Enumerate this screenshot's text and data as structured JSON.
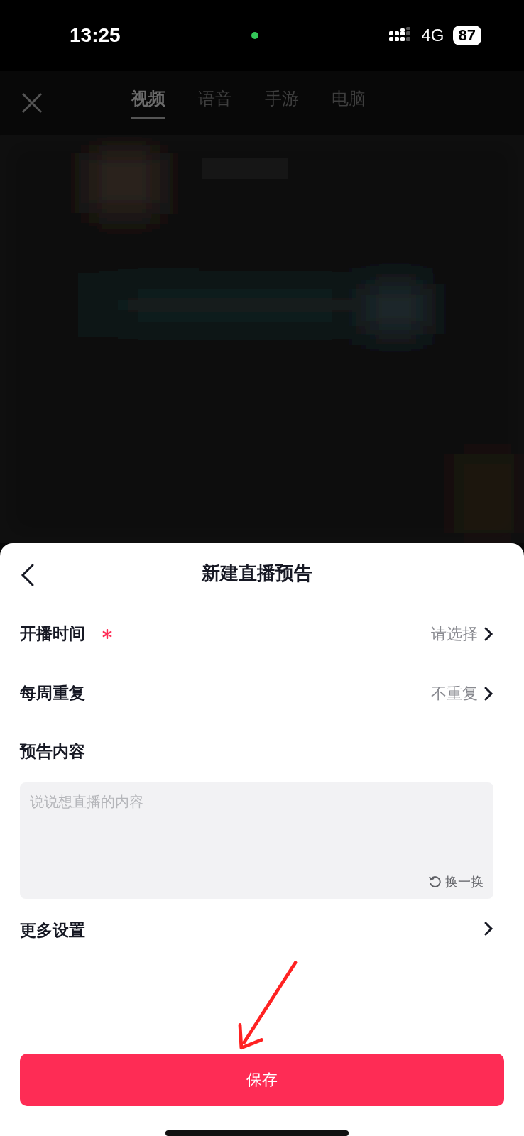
{
  "status_bar": {
    "time": "13:25",
    "network": "4G",
    "battery": "87"
  },
  "nav": {
    "tabs": [
      {
        "label": "视频",
        "selected": true
      },
      {
        "label": "语音",
        "selected": false
      },
      {
        "label": "手游",
        "selected": false
      },
      {
        "label": "电脑",
        "selected": false
      }
    ]
  },
  "sheet": {
    "title": "新建直播预告",
    "rows": [
      {
        "kind": "select",
        "label": "开播时间",
        "required": true,
        "value": "请选择"
      },
      {
        "kind": "select",
        "label": "每周重复",
        "required": false,
        "value": "不重复"
      },
      {
        "kind": "textarea",
        "label": "预告内容",
        "placeholder": "说说想直播的内容",
        "action": "换一换"
      },
      {
        "kind": "link",
        "label": "更多设置"
      }
    ],
    "save_button": "保存"
  }
}
